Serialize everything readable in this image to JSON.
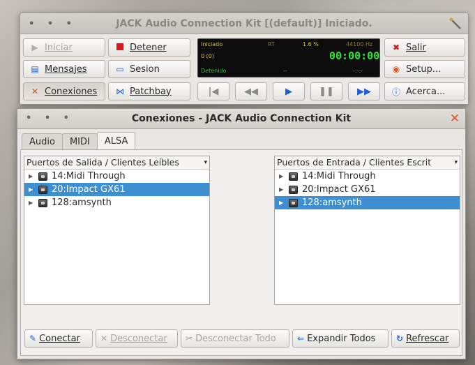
{
  "main_window": {
    "title": "JACK Audio Connection Kit [(default)] Iniciado.",
    "buttons": {
      "iniciar": "Iniciar",
      "detener": "Detener",
      "salir": "Salir",
      "mensajes": "Mensajes",
      "sesion": "Sesion",
      "setup": "Setup...",
      "conexiones": "Conexiones",
      "patchbay": "Patchbay",
      "acerca": "Acerca..."
    },
    "display": {
      "status": "Iniciado",
      "rt": "RT",
      "dsp_load": "1.6 %",
      "sample_rate": "44100 Hz",
      "xruns": "0 (0)",
      "time": "00:00:00",
      "transport_state": "Detenido",
      "dash": "--",
      "bpm": "-:-:-"
    },
    "transport_icons": [
      "rewind-to-start-icon",
      "rewind-icon",
      "play-icon",
      "pause-icon",
      "fast-forward-icon"
    ]
  },
  "connections_window": {
    "title": "Conexiones - JACK Audio Connection Kit",
    "tabs": [
      "Audio",
      "MIDI",
      "ALSA"
    ],
    "active_tab": "ALSA",
    "outputs": {
      "header": "Puertos de Salida / Clientes Leíbles",
      "items": [
        {
          "label": "14:Midi Through",
          "selected": false
        },
        {
          "label": "20:Impact GX61",
          "selected": true
        },
        {
          "label": "128:amsynth",
          "selected": false
        }
      ]
    },
    "inputs": {
      "header": "Puertos de Entrada / Clientes Escrit",
      "items": [
        {
          "label": "14:Midi Through",
          "selected": false
        },
        {
          "label": "20:Impact GX61",
          "selected": false
        },
        {
          "label": "128:amsynth",
          "selected": true
        }
      ]
    },
    "buttons": {
      "conectar": "Conectar",
      "desconectar": "Desconectar",
      "desconectar_todo": "Desconectar Todo",
      "expandir": "Expandir Todos",
      "refrescar": "Refrescar"
    }
  },
  "colors": {
    "selection": "#3d8fd1",
    "display_time": "#2ee82e",
    "accent_blue": "#1f5fd6",
    "close_orange": "#e0531f"
  }
}
